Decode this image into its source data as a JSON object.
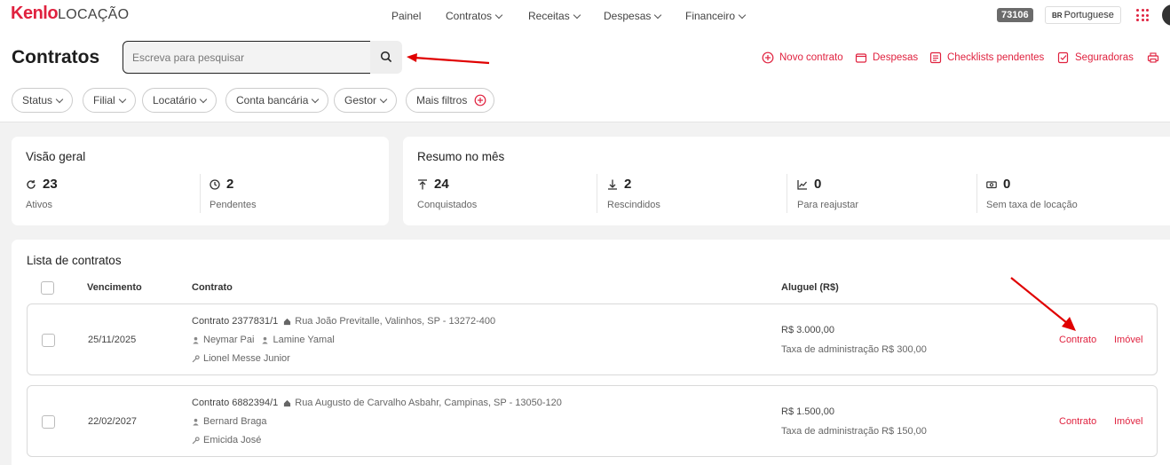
{
  "brand": {
    "logo_main": "Kenlo",
    "logo_sub": "LOCAÇÃO"
  },
  "nav": [
    "Painel",
    "Contratos",
    "Receitas",
    "Despesas",
    "Financeiro"
  ],
  "header_right": {
    "badge": "73106",
    "lang_flag": "BR",
    "lang": "Portuguese"
  },
  "page": {
    "title": "Contratos"
  },
  "search": {
    "placeholder": "Escreva para pesquisar",
    "value": ""
  },
  "actions": [
    "Novo contrato",
    "Despesas",
    "Checklists pendentes",
    "Seguradoras"
  ],
  "filters": [
    "Status",
    "Filial",
    "Locatário",
    "Conta bancária",
    "Gestor",
    "Mais filtros"
  ],
  "overview": {
    "title": "Visão geral",
    "stats": [
      {
        "value": "23",
        "label": "Ativos",
        "icon": "refresh-icon"
      },
      {
        "value": "2",
        "label": "Pendentes",
        "icon": "clock-icon"
      }
    ]
  },
  "summary": {
    "title": "Resumo no mês",
    "stats": [
      {
        "value": "24",
        "label": "Conquistados",
        "icon": "arrow-up-bar-icon"
      },
      {
        "value": "2",
        "label": "Rescindidos",
        "icon": "arrow-down-bar-icon"
      },
      {
        "value": "0",
        "label": "Para reajustar",
        "icon": "trend-up-icon"
      },
      {
        "value": "0",
        "label": "Sem taxa de locação",
        "icon": "money-icon"
      }
    ]
  },
  "list": {
    "title": "Lista de contratos",
    "headers": {
      "due": "Vencimento",
      "contract": "Contrato",
      "rent": "Aluguel (R$)"
    },
    "rows": [
      {
        "due": "25/11/2025",
        "contract": "Contrato 2377831/1",
        "address": "Rua João Previtalle, Valinhos, SP - 13272-400",
        "tenants": [
          "Neymar Pai",
          "Lamine Yamal"
        ],
        "owner": "Lionel Messe Junior",
        "rent": "R$ 3.000,00",
        "fee": "Taxa de administração R$ 300,00",
        "link_contract": "Contrato",
        "link_property": "Imóvel"
      },
      {
        "due": "22/02/2027",
        "contract": "Contrato 6882394/1",
        "address": "Rua Augusto de Carvalho Asbahr, Campinas, SP - 13050-120",
        "tenants": [
          "Bernard Braga"
        ],
        "owner": "Emicida José",
        "rent": "R$ 1.500,00",
        "fee": "Taxa de administração R$ 150,00",
        "link_contract": "Contrato",
        "link_property": "Imóvel"
      }
    ]
  },
  "colors": {
    "accent": "#e0223f",
    "annotation": "#e00000",
    "background": "#f2f2f2"
  }
}
